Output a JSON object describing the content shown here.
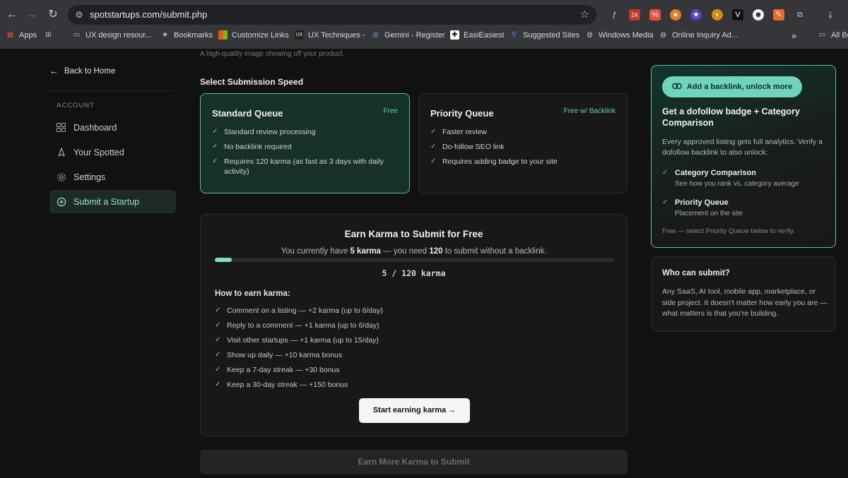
{
  "browser": {
    "url": "spotstartups.com/submit.php",
    "bookmarks": [
      {
        "label": "Apps",
        "icon": "apps-grid-icon",
        "color": "#e3463a"
      },
      {
        "label": "",
        "icon": "tab-groups-icon",
        "color": "#bdbdbd"
      },
      {
        "label": "UX design resour...",
        "icon": "folder-icon",
        "color": "#bdbdbd"
      },
      {
        "label": "Bookmarks",
        "icon": "star-icon",
        "color": "#bdbdbd"
      },
      {
        "label": "Customize Links",
        "icon": "microsoft-icon",
        "color": "#f25022"
      },
      {
        "label": "UX Techniques -",
        "icon": "ux-icon",
        "color": "#222"
      },
      {
        "label": "Gemini - Register",
        "icon": "gemini-icon",
        "color": "#8ab4f8"
      },
      {
        "label": "EasiEasiest",
        "icon": "easi-icon",
        "color": "#ffffff"
      },
      {
        "label": "Suggested Sites",
        "icon": "search-icon",
        "color": "#4a8af4"
      },
      {
        "label": "Windows Media",
        "icon": "globe-icon",
        "color": "#bdbdbd"
      },
      {
        "label": "Online Inquiry Ad...",
        "icon": "globe-icon",
        "color": "#bdbdbd"
      },
      {
        "label": "All Bo",
        "icon": "folder-icon",
        "color": "#bdbdbd"
      }
    ],
    "ext_badge": "24"
  },
  "sidebar": {
    "back_label": "Back to Home",
    "heading": "ACCOUNT",
    "items": [
      {
        "label": "Dashboard",
        "icon": "grid-icon"
      },
      {
        "label": "Your Spotted",
        "icon": "rocket-icon"
      },
      {
        "label": "Settings",
        "icon": "gear-icon"
      },
      {
        "label": "Submit a Startup",
        "icon": "plus-circle-icon"
      }
    ]
  },
  "main": {
    "image_hint": "A high-quality image showing off your product.",
    "speed_title": "Select Submission Speed",
    "queues": [
      {
        "name": "Standard Queue",
        "tag": "Free",
        "features": [
          "Standard review processing",
          "No backlink required",
          "Requires 120 karma (as fast as 3 days with daily activity)"
        ]
      },
      {
        "name": "Priority Queue",
        "tag": "Free w/ Backlink",
        "features": [
          "Faster review",
          "Do-follow SEO link",
          "Requires adding badge to your site"
        ]
      }
    ],
    "karma": {
      "title": "Earn Karma to Submit for Free",
      "sub_prefix": "You currently have ",
      "current": "5 karma",
      "sub_mid": " — you need ",
      "needed": "120",
      "sub_suffix": " to submit without a backlink.",
      "progress_fraction": 0.0417,
      "count_text": "5 / 120 karma",
      "how_title": "How to earn karma:",
      "ways": [
        "Comment on a listing — +2 karma (up to 6/day)",
        "Reply to a comment — +1 karma (up to 6/day)",
        "Visit other startups — +1 karma (up to 15/day)",
        "Show up daily — +10 karma bonus",
        "Keep a 7-day streak — +30 bonus",
        "Keep a 30-day streak — +150 bonus"
      ],
      "start_label": "Start earning karma →"
    },
    "submit_label": "Earn More Karma to Submit"
  },
  "promo": {
    "pill_label": "Add a backlink, unlock more",
    "title": "Get a dofollow badge + Category Comparison",
    "desc": "Every approved listing gets full analytics. Verify a dofollow backlink to also unlock:",
    "items": [
      {
        "title": "Category Comparison",
        "sub": "See how you rank vs. category average"
      },
      {
        "title": "Priority Queue",
        "sub": "Placement on the site"
      }
    ],
    "foot": "Free — select Priority Queue below to verify."
  },
  "who": {
    "title": "Who can submit?",
    "text": "Any SaaS, AI tool, mobile app, marketplace, or side project. It doesn't matter how early you are — what matters is that you're building."
  },
  "colors": {
    "accent": "#5ed0b5",
    "accent_light": "#6fd4bb",
    "background": "#111112",
    "card": "#18181a"
  }
}
